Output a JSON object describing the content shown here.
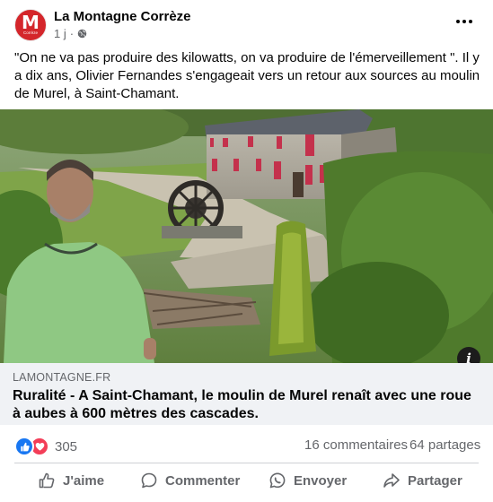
{
  "post": {
    "page_name": "La Montagne Corrèze",
    "avatar_letter": "M",
    "avatar_sub": "Corrèze",
    "time": "1 j",
    "separator": "·",
    "text": "\"On ne va pas produire des kilowatts, on va produire de l'émerveillement \". Il y a dix ans, Olivier Fernandes s'engageait vers un retour aux sources au moulin de Murel, à Saint-Chamant."
  },
  "link": {
    "domain": "LAMONTAGNE.FR",
    "title": "Ruralité - A Saint-Chamant, le moulin de Murel renaît avec une roue à aubes à 600 mètres des cascades."
  },
  "stats": {
    "reactions": "305",
    "comments": "16 commentaires",
    "shares": "64 partages"
  },
  "actions": {
    "like": "J'aime",
    "comment": "Commenter",
    "send": "Envoyer",
    "share": "Partager"
  },
  "icons": {
    "globe": "globe-icon",
    "more": "more-options-icon",
    "info": "info-icon",
    "like_reaction": "like-reaction-icon",
    "love_reaction": "love-reaction-icon"
  },
  "colors": {
    "brand": "#d4262b",
    "like_blue": "#1877f2",
    "love_red": "#f33e58",
    "secondary_text": "#65676b",
    "link_bg": "#f0f2f5"
  }
}
